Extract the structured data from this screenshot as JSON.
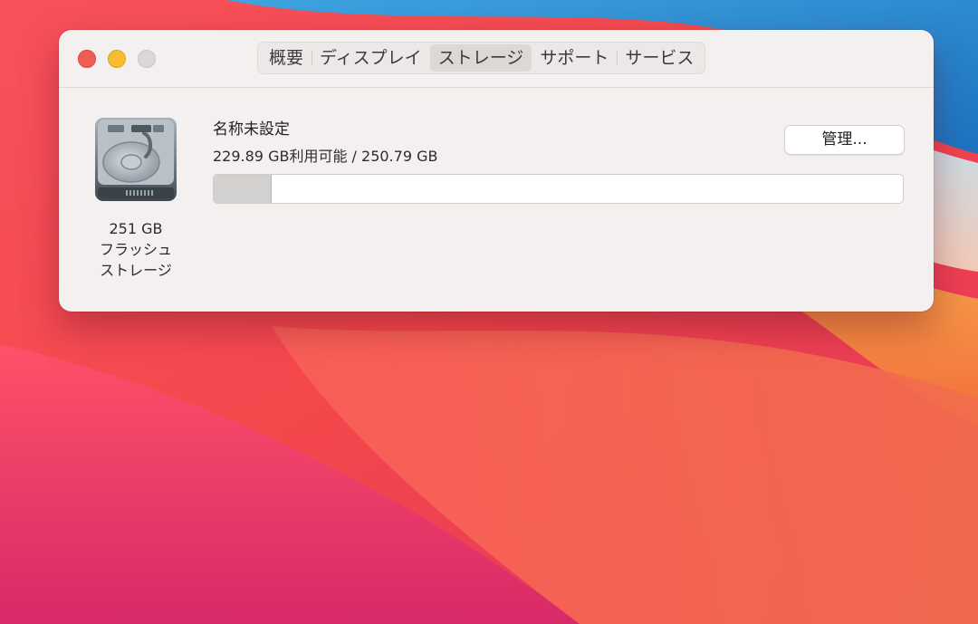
{
  "window": {
    "tabs": [
      {
        "label": "概要",
        "active": false
      },
      {
        "label": "ディスプレイ",
        "active": false
      },
      {
        "label": "ストレージ",
        "active": true
      },
      {
        "label": "サポート",
        "active": false
      },
      {
        "label": "サービス",
        "active": false
      }
    ]
  },
  "storage": {
    "disk_icon": "hard-drive-icon",
    "disk_size": "251 GB",
    "disk_type_line1": "フラッシュ",
    "disk_type_line2": "ストレージ",
    "volume_name": "名称未設定",
    "volume_info": "229.89 GB利用可能 / 250.79 GB",
    "used_fraction": 0.083,
    "manage_label": "管理..."
  },
  "colors": {
    "close": "#ee5e57",
    "minimize": "#f5bd30",
    "zoom": "#dad7d6",
    "usage_fill": "#d3d1d0"
  }
}
